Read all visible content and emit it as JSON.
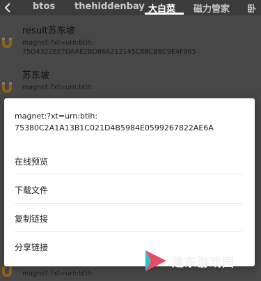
{
  "tabs": [
    "btos",
    "thehiddenbay",
    "大白菜",
    "磁力管家",
    "卧"
  ],
  "active_tab_index": 2,
  "list": [
    {
      "title": "result苏东坡",
      "link1": "magnet:?xt=urn:btih:",
      "link2": "75D4322EE7DAAE2BD86A212145C8BCBBC9E4F965"
    },
    {
      "title": "苏东坡",
      "link1": "magnet:?xt=urn:btih:",
      "link2": ""
    },
    {
      "title": "",
      "link1": "magnet:?xt=urn:btih:",
      "link2": ""
    }
  ],
  "dialog": {
    "link_line1": "magnet:?xt=urn:btih:",
    "link_line2": "75380C2A1A13B1C021D4B5984E0599267822AE6A",
    "options": [
      "在线预览",
      "下载文件",
      "复制链接",
      "分享链接"
    ]
  },
  "watermark": {
    "text": "建东游戏园"
  },
  "colors": {
    "tab_bar": "#3b3b3b",
    "magnet_icon": "#f0a92d",
    "dialog_bg": "#ffffff"
  }
}
